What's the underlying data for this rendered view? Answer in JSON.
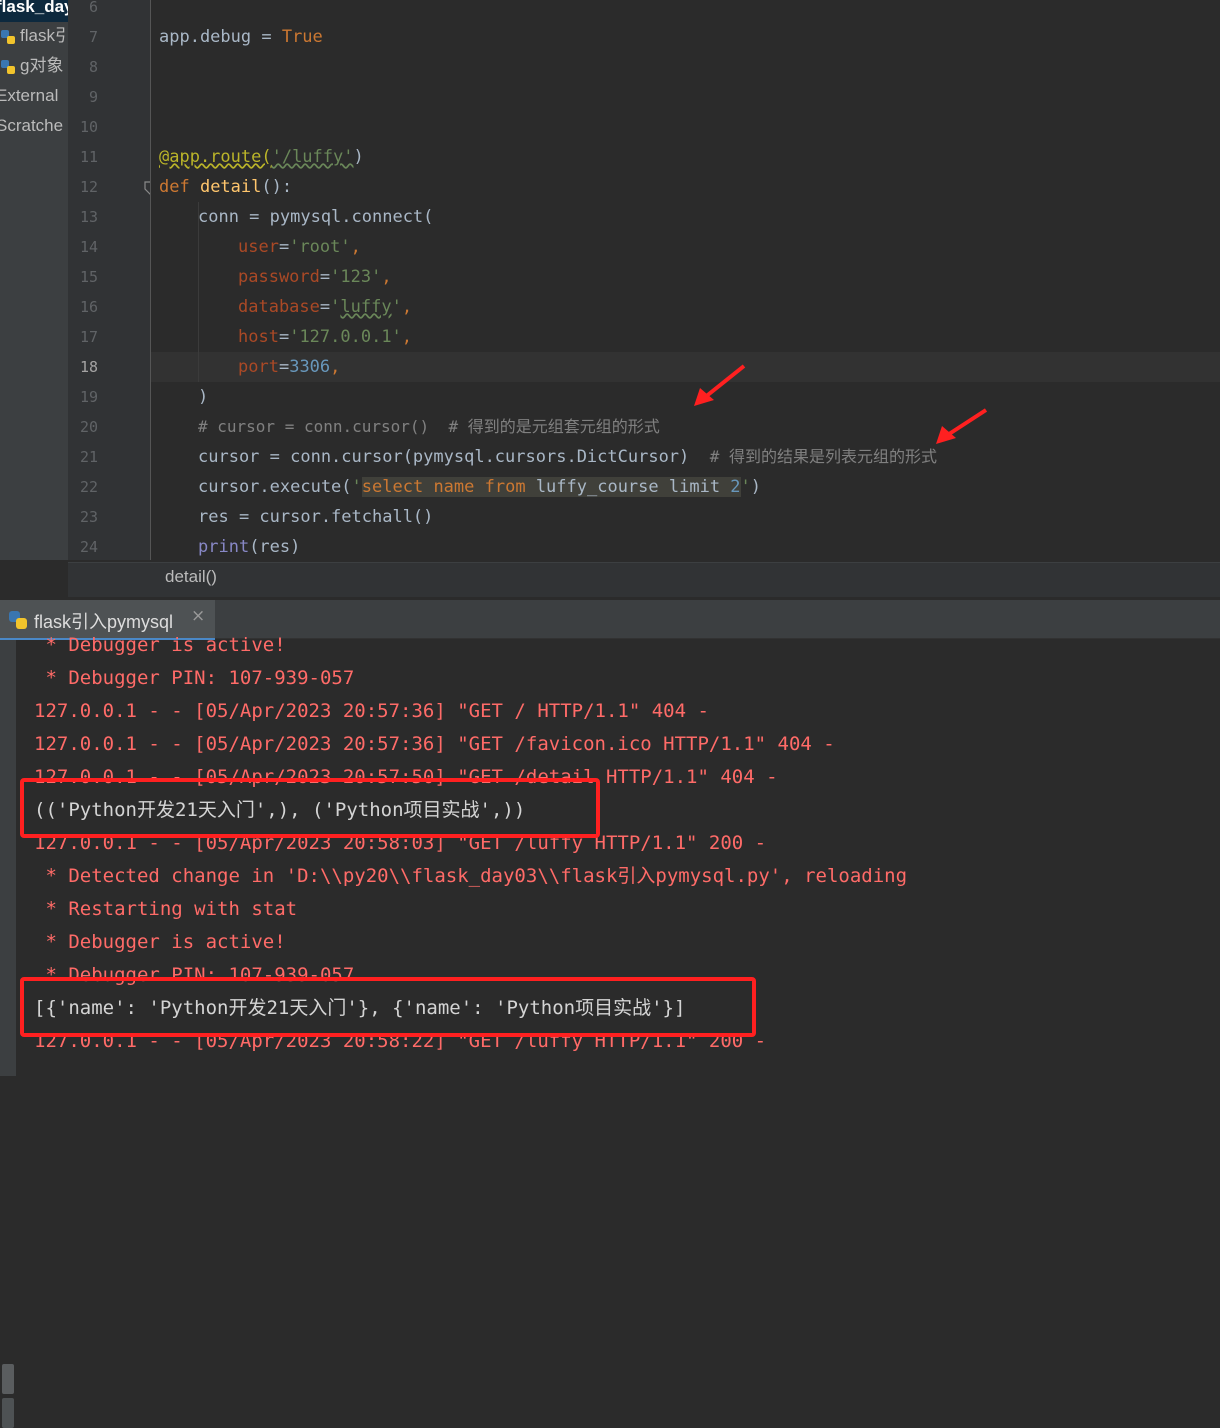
{
  "project_tree": {
    "items": [
      "flask_day",
      "flask引",
      "g对象",
      "External",
      "Scratche"
    ]
  },
  "editor": {
    "line_numbers": [
      "6",
      "7",
      "8",
      "9",
      "10",
      "11",
      "12",
      "13",
      "14",
      "15",
      "16",
      "17",
      "18",
      "19",
      "20",
      "21",
      "22",
      "23",
      "24"
    ],
    "current_line": "18",
    "code": {
      "l7": {
        "a": "app.debug = ",
        "b": "True"
      },
      "l11": {
        "decorator": "@app.route(",
        "str": "'/luffy'",
        "close": ")"
      },
      "l12": {
        "kw": "def ",
        "fn": "detail",
        "rest": "():"
      },
      "l13": {
        "text": "conn = pymysql.connect("
      },
      "l14": {
        "param": "user",
        "eq": "=",
        "str": "'root'",
        "comma": ","
      },
      "l15": {
        "param": "password",
        "eq": "=",
        "str": "'123'",
        "comma": ","
      },
      "l16": {
        "param": "database",
        "eq": "=",
        "str_a": "'",
        "str_b": "luffy",
        "str_c": "'",
        "comma": ","
      },
      "l17": {
        "param": "host",
        "eq": "=",
        "str": "'127.0.0.1'",
        "comma": ","
      },
      "l18": {
        "param": "port",
        "eq": "=",
        "num": "3306",
        "comma": ","
      },
      "l19": {
        "text": ")"
      },
      "l20": {
        "comment": "# cursor = conn.cursor()  # 得到的是元组套元组的形式"
      },
      "l21": {
        "text": "cursor = conn.cursor(pymysql.cursors.DictCursor)  ",
        "comment": "# 得到的结果是列表元组的形式"
      },
      "l22": {
        "a": "cursor.execute(",
        "q1": "'",
        "sel": "select ",
        "name": "name ",
        "from": "from ",
        "rest": "luffy_course ",
        "limit": "limit ",
        "two": "2",
        "q2": "'",
        ")": ")"
      },
      "l23": {
        "text": "res = cursor.fetchall()"
      },
      "l24": {
        "builtin": "print",
        "rest": "(res)"
      }
    }
  },
  "breadcrumb": {
    "text": "detail()"
  },
  "run_panel": {
    "tab_label": "flask引入pymysql",
    "close_glyph": "×"
  },
  "console": {
    "lines": [
      " * Debugger is active!",
      " * Debugger PIN: 107-939-057",
      "127.0.0.1 - - [05/Apr/2023 20:57:36] \"GET / HTTP/1.1\" 404 -",
      "127.0.0.1 - - [05/Apr/2023 20:57:36] \"GET /favicon.ico HTTP/1.1\" 404 -",
      "127.0.0.1 - - [05/Apr/2023 20:57:50] \"GET /detail HTTP/1.1\" 404 -",
      "(('Python开发21天入门',), ('Python项目实战',))",
      "127.0.0.1 - - [05/Apr/2023 20:58:03] \"GET /luffy HTTP/1.1\" 200 -",
      " * Detected change in 'D:\\\\py20\\\\flask_day03\\\\flask引入pymysql.py', reloading",
      " * Restarting with stat",
      " * Debugger is active!",
      " * Debugger PIN: 107-939-057",
      "[{'name': 'Python开发21天入门'}, {'name': 'Python项目实战'}]",
      "127.0.0.1 - - [05/Apr/2023 20:58:22] \"GET /luffy HTTP/1.1\" 200 -"
    ]
  },
  "colors": {
    "editor_bg": "#2b2b2b",
    "annotation_red": "#ff2020",
    "console_stderr": "#ff6b68"
  }
}
